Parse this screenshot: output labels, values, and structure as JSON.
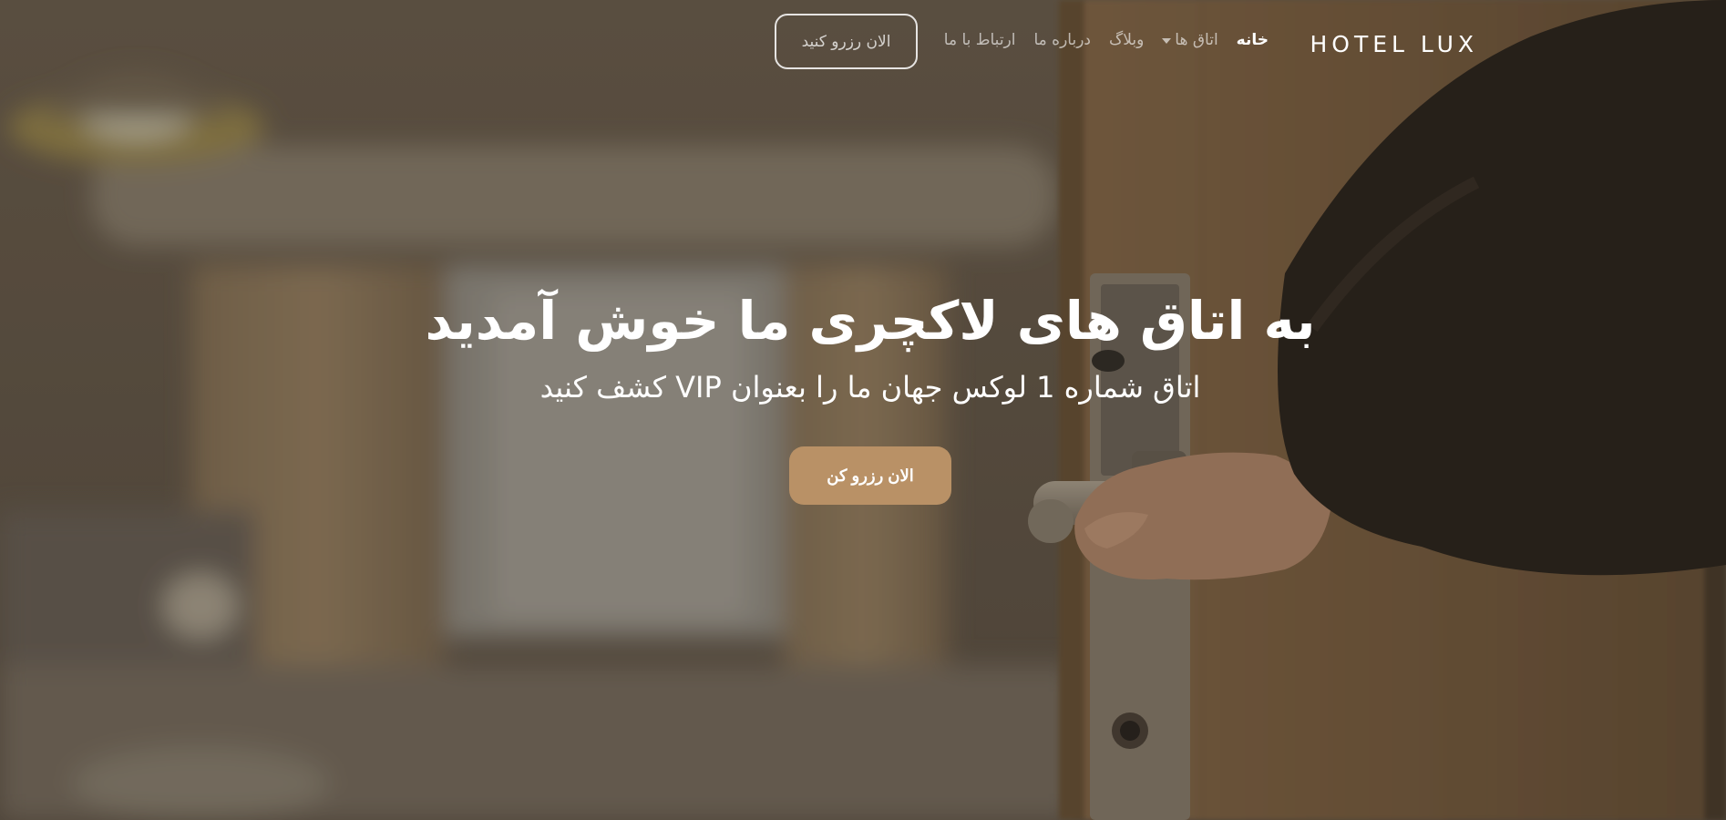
{
  "navbar": {
    "brand": "HOTEL LUX",
    "links": [
      {
        "label": "خانه",
        "active": true
      },
      {
        "label": "اتاق ها",
        "has_dropdown": true
      },
      {
        "label": "وبلاگ"
      },
      {
        "label": "درباره ما"
      },
      {
        "label": "ارتباط با ما"
      }
    ],
    "book_button": "الان رزرو کنید"
  },
  "hero": {
    "title": "به اتاق های لاکچری ما خوش آمدید",
    "subtitle": "اتاق شماره 1 لوکس جهان ما را بعنوان VIP کشف کنید",
    "cta": "الان رزرو کن"
  },
  "colors": {
    "accent": "#b99166",
    "text": "#ffffff"
  },
  "icons": {
    "dropdown": "caret-down-icon"
  }
}
